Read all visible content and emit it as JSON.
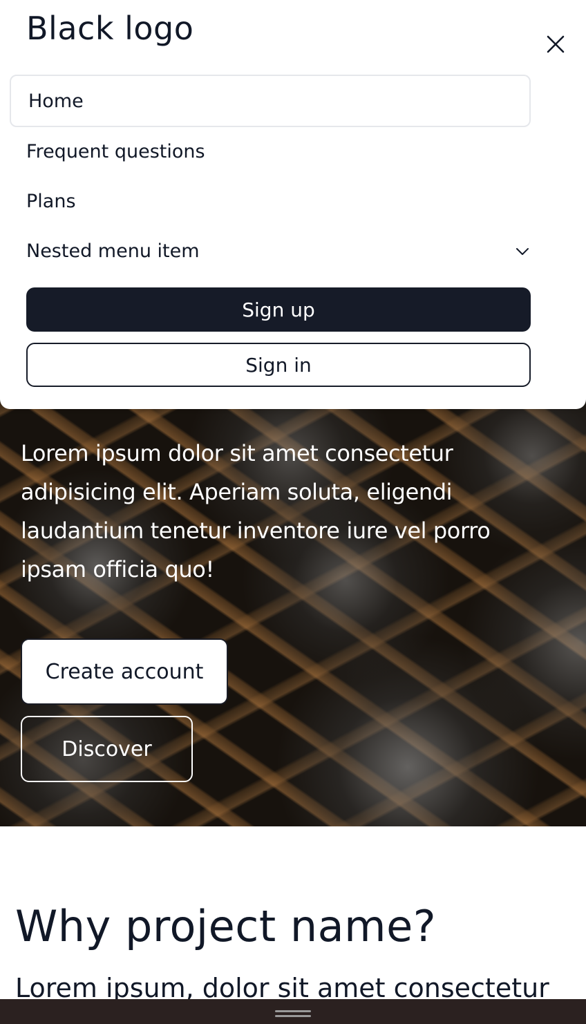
{
  "header": {
    "logo_text": "Black logo",
    "close_icon": "close-icon"
  },
  "menu": {
    "items": [
      {
        "label": "Home",
        "active": true
      },
      {
        "label": "Frequent questions"
      },
      {
        "label": "Plans"
      },
      {
        "label": "Nested menu item",
        "icon": "chevron-down-icon"
      }
    ],
    "sign_up_label": "Sign up",
    "sign_in_label": "Sign in"
  },
  "hero": {
    "text": "Lorem ipsum dolor sit amet consectetur adipisicing elit. Aperiam soluta, eligendi laudantium tenetur inventore iure vel porro ipsam officia quo!",
    "primary_button": "Create account",
    "secondary_button": "Discover"
  },
  "section": {
    "title": "Why project name?",
    "text": "Lorem ipsum, dolor sit amet consectetur"
  },
  "colors": {
    "primary": "#161b28",
    "text": "#111827",
    "border": "#e5e7eb",
    "bottom_bar": "#2b2120"
  }
}
